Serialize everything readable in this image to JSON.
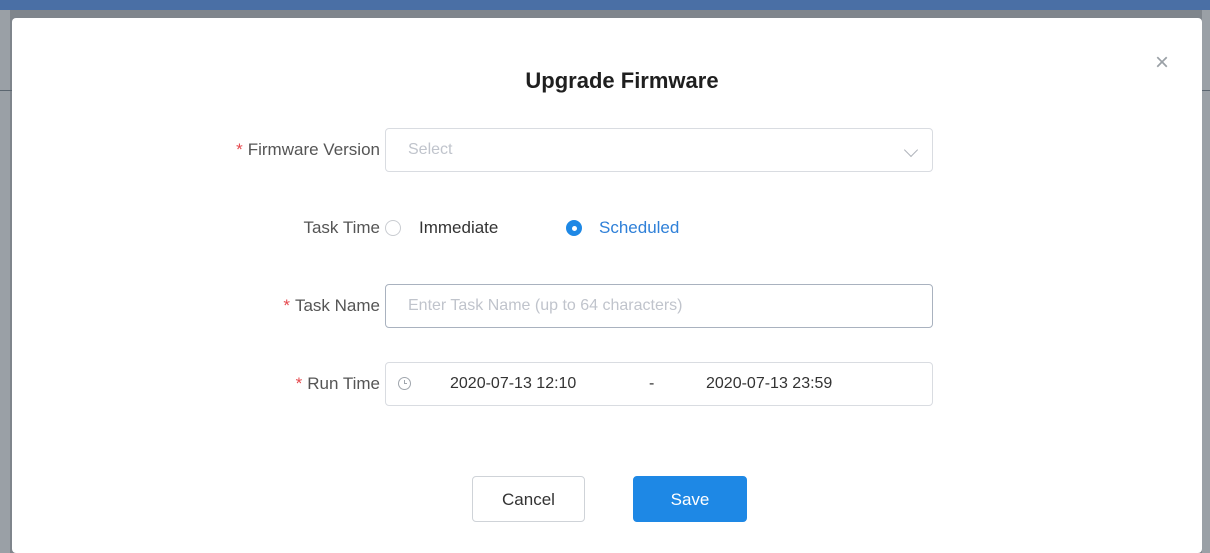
{
  "dialog": {
    "title": "Upgrade Firmware",
    "close_icon": "close-icon",
    "close_glyph": "×"
  },
  "form": {
    "firmware_version": {
      "required_mark": "*",
      "label": "Firmware Version",
      "placeholder": "Select",
      "icon": "chevron-down-icon"
    },
    "task_time": {
      "label": "Task Time",
      "options": [
        {
          "label": "Immediate",
          "checked": false
        },
        {
          "label": "Scheduled",
          "checked": true
        }
      ]
    },
    "task_name": {
      "required_mark": "*",
      "label": "Task Name",
      "placeholder": "Enter Task Name (up to 64 characters)",
      "value": ""
    },
    "run_time": {
      "required_mark": "*",
      "label": "Run Time",
      "icon": "clock-icon",
      "start": "2020-07-13 12:10",
      "separator": "-",
      "end": "2020-07-13 23:59"
    }
  },
  "actions": {
    "cancel_label": "Cancel",
    "save_label": "Save"
  },
  "colors": {
    "primary": "#1e88e5",
    "required": "#e5484d",
    "selected_text": "#2f80d8"
  }
}
